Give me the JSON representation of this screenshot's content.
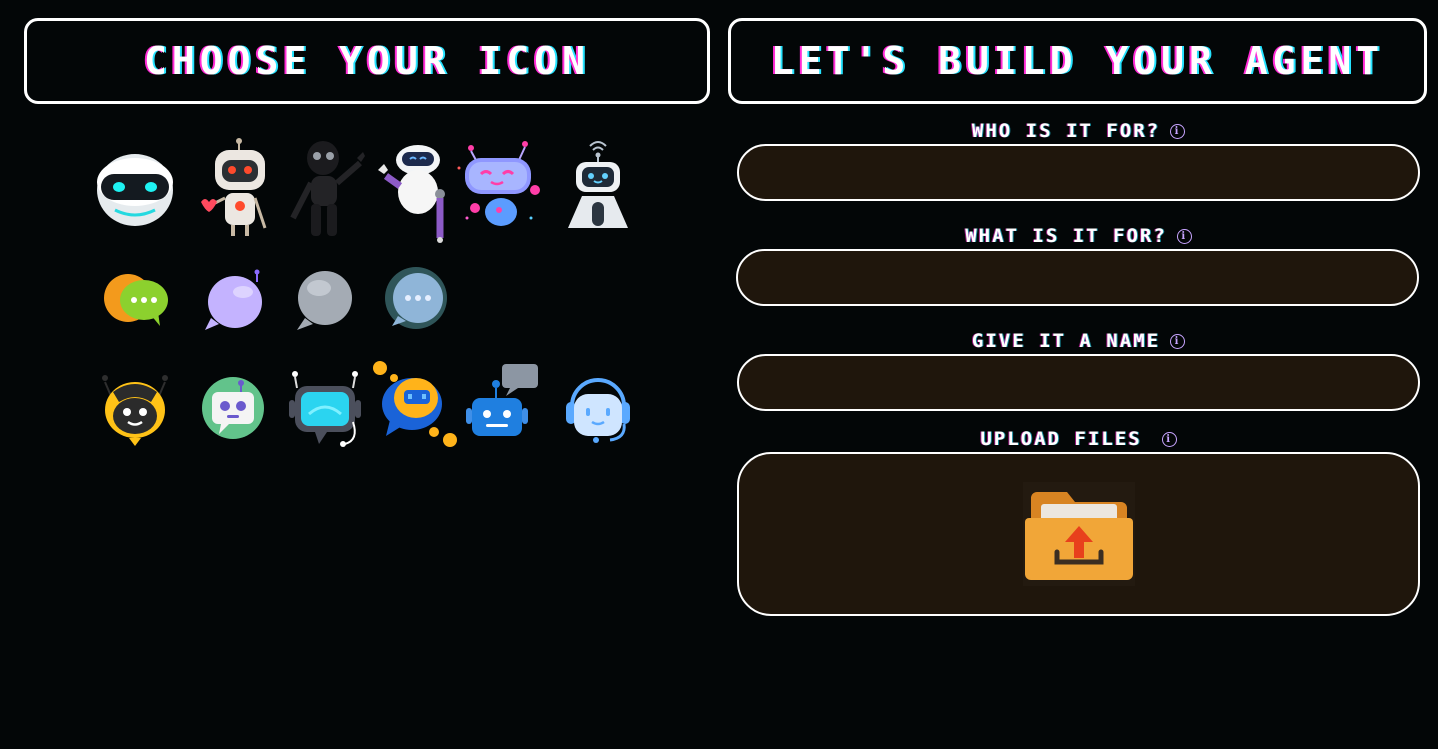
{
  "left_panel": {
    "title": "CHOOSE YOUR ICON"
  },
  "right_panel": {
    "title": "LET'S BUILD YOUR AGENT"
  },
  "icon_grid": {
    "row1": [
      "round-robot-head-icon",
      "red-eyed-robot-icon",
      "black-robot-waving-icon",
      "white-robot-holding-icon",
      "pink-flying-robot-icon",
      "white-antenna-robot-icon"
    ],
    "row2": [
      "chat-bubbles-icon",
      "purple-chat-bubble-icon",
      "gray-chat-bubble-icon",
      "blue-chat-bubble-icon"
    ],
    "row3": [
      "yellow-bee-bot-icon",
      "green-bot-badge-icon",
      "monitor-robot-icon",
      "speech-bubble-bot-icon",
      "blue-robot-message-icon",
      "headset-bot-icon"
    ]
  },
  "form": {
    "who_label": "WHO IS IT FOR?",
    "who_value": "",
    "what_label": "WHAT IS IT FOR?",
    "what_value": "",
    "name_label": "GIVE IT A NAME",
    "name_value": "",
    "upload_label": "UPLOAD FILES",
    "info_glyph": "i",
    "upload_icon": "folder-upload-icon"
  },
  "colors": {
    "background": "#030607",
    "field_fill": "#1f160c",
    "accent_pink": "#ff2bd6",
    "accent_cyan": "#25e3ff",
    "info_purple": "#c8a4ff",
    "folder_orange": "#f1a638",
    "arrow_red": "#e8401c"
  }
}
